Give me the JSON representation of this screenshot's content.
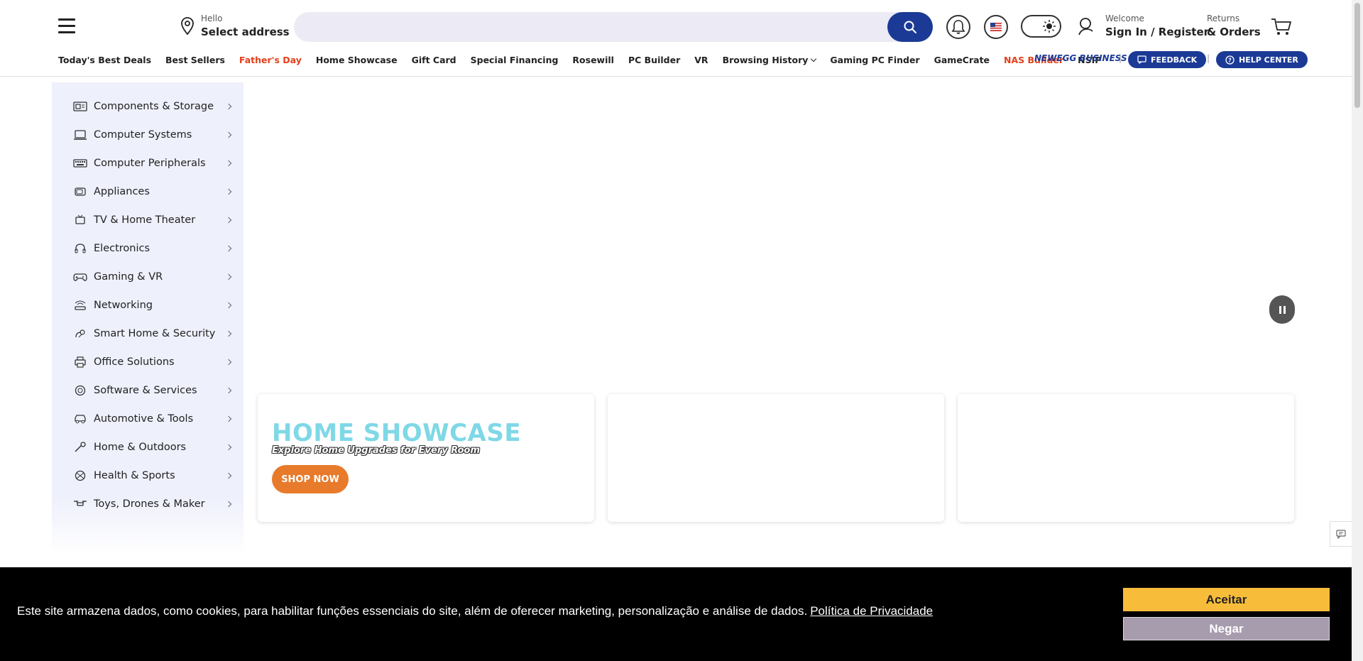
{
  "header": {
    "address_hello": "Hello",
    "address_select": "Select address",
    "search_placeholder": "",
    "account_welcome": "Welcome",
    "account_signin": "Sign In / Register",
    "orders_returns": "Returns",
    "orders_orders": "& Orders"
  },
  "nav": {
    "links": [
      "Today's Best Deals",
      "Best Sellers",
      "Father's Day",
      "Home Showcase",
      "Gift Card",
      "Special Financing",
      "Rosewill",
      "PC Builder",
      "VR",
      "Browsing History",
      "Gaming PC Finder",
      "GameCrate",
      "NAS Builder",
      "NSIP"
    ],
    "business": "NEWEGG BUSINESS",
    "feedback": "FEEDBACK",
    "help_center": "HELP CENTER"
  },
  "sidebar": {
    "items": [
      {
        "label": "Components & Storage",
        "icon": "components-icon"
      },
      {
        "label": "Computer Systems",
        "icon": "laptop-icon"
      },
      {
        "label": "Computer Peripherals",
        "icon": "keyboard-icon"
      },
      {
        "label": "Appliances",
        "icon": "microwave-icon"
      },
      {
        "label": "TV & Home Theater",
        "icon": "tv-icon"
      },
      {
        "label": "Electronics",
        "icon": "headphones-icon"
      },
      {
        "label": "Gaming & VR",
        "icon": "gamepad-icon"
      },
      {
        "label": "Networking",
        "icon": "router-icon"
      },
      {
        "label": "Smart Home & Security",
        "icon": "smart-home-icon"
      },
      {
        "label": "Office Solutions",
        "icon": "printer-icon"
      },
      {
        "label": "Software & Services",
        "icon": "software-icon"
      },
      {
        "label": "Automotive & Tools",
        "icon": "car-icon"
      },
      {
        "label": "Home & Outdoors",
        "icon": "tools-icon"
      },
      {
        "label": "Health & Sports",
        "icon": "sports-icon"
      },
      {
        "label": "Toys, Drones & Maker",
        "icon": "drone-icon"
      }
    ]
  },
  "promo": {
    "title": "HOME SHOWCASE",
    "subtitle": "Explore Home Upgrades for Every Room",
    "button": "SHOP NOW"
  },
  "cookie": {
    "text": "Este site armazena dados, como cookies, para habilitar funções essenciais do site, além de oferecer marketing, personalização e análise de dados.",
    "link": "Política de Privacidade",
    "accept": "Aceitar",
    "deny": "Negar"
  },
  "colors": {
    "brand_blue": "#1b3a95",
    "accent_orange": "#e87a2b",
    "red_link": "#e2401c",
    "accept_yellow": "#f7bd3a"
  }
}
